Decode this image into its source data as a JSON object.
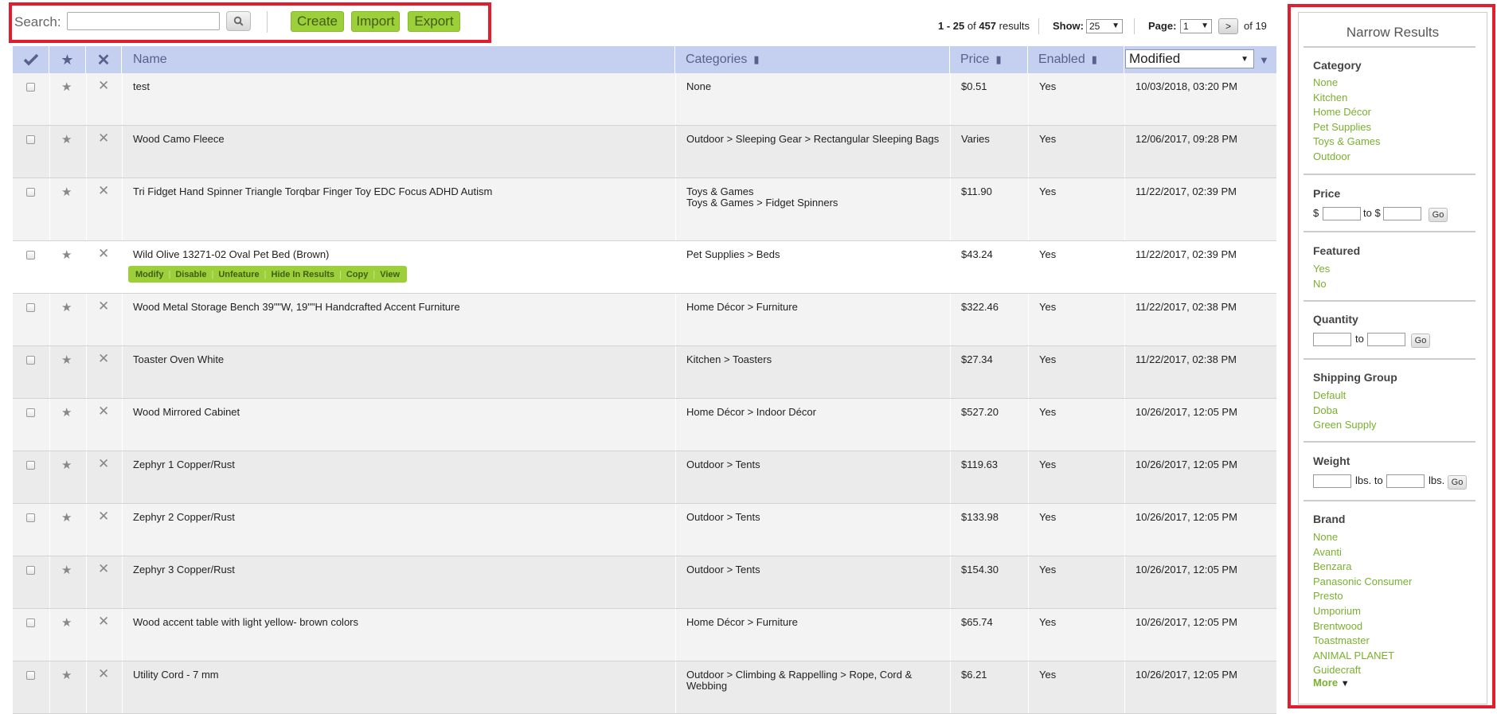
{
  "toolbar": {
    "search_label": "Search:",
    "search_value": "",
    "search_icon": "magnifier-icon",
    "create_label": "Create",
    "import_label": "Import",
    "export_label": "Export",
    "accent_color": "#9ccf3a",
    "highlight_color": "#e01e2e"
  },
  "pagination": {
    "range": "1 - 25",
    "of_word": "of",
    "total": "457",
    "results_word": "results",
    "show_label": "Show:",
    "show_value": "25",
    "page_label": "Page:",
    "page_value": "1",
    "next_label": ">",
    "of_pages": "of 19"
  },
  "table": {
    "header_icons": [
      "checkmark-icon",
      "star-icon",
      "close-icon"
    ],
    "columns": {
      "name": "Name",
      "categories": "Categories",
      "price": "Price",
      "enabled": "Enabled",
      "modified": "Modified"
    },
    "rows": [
      {
        "name": "test",
        "categories": [
          "None"
        ],
        "price": "$0.51",
        "enabled": "Yes",
        "modified": "10/03/2018, 03:20 PM"
      },
      {
        "name": "Wood Camo Fleece",
        "categories": [
          "Outdoor > Sleeping Gear > Rectangular Sleeping Bags"
        ],
        "price": "Varies",
        "enabled": "Yes",
        "modified": "12/06/2017, 09:28 PM"
      },
      {
        "name": "Tri Fidget Hand Spinner Triangle Torqbar Finger Toy EDC Focus ADHD Autism",
        "categories": [
          "Toys & Games",
          "Toys & Games > Fidget Spinners"
        ],
        "price": "$11.90",
        "enabled": "Yes",
        "modified": "11/22/2017, 02:39 PM"
      },
      {
        "name": "Wild Olive 13271-02 Oval Pet Bed (Brown)",
        "categories": [
          "Pet Supplies > Beds"
        ],
        "price": "$43.24",
        "enabled": "Yes",
        "modified": "11/22/2017, 02:39 PM"
      },
      {
        "name": "Wood Metal Storage Bench 39\"\"W, 19\"\"H Handcrafted Accent Furniture",
        "categories": [
          "Home Décor > Furniture"
        ],
        "price": "$322.46",
        "enabled": "Yes",
        "modified": "11/22/2017, 02:38 PM"
      },
      {
        "name": "Toaster Oven White",
        "categories": [
          "Kitchen > Toasters"
        ],
        "price": "$27.34",
        "enabled": "Yes",
        "modified": "11/22/2017, 02:38 PM"
      },
      {
        "name": "Wood Mirrored Cabinet",
        "categories": [
          "Home Décor > Indoor Décor"
        ],
        "price": "$527.20",
        "enabled": "Yes",
        "modified": "10/26/2017, 12:05 PM"
      },
      {
        "name": "Zephyr 1 Copper/Rust",
        "categories": [
          "Outdoor > Tents"
        ],
        "price": "$119.63",
        "enabled": "Yes",
        "modified": "10/26/2017, 12:05 PM"
      },
      {
        "name": "Zephyr 2 Copper/Rust",
        "categories": [
          "Outdoor > Tents"
        ],
        "price": "$133.98",
        "enabled": "Yes",
        "modified": "10/26/2017, 12:05 PM"
      },
      {
        "name": "Zephyr 3 Copper/Rust",
        "categories": [
          "Outdoor > Tents"
        ],
        "price": "$154.30",
        "enabled": "Yes",
        "modified": "10/26/2017, 12:05 PM"
      },
      {
        "name": "Wood accent table with light yellow- brown colors",
        "categories": [
          "Home Décor > Furniture"
        ],
        "price": "$65.74",
        "enabled": "Yes",
        "modified": "10/26/2017, 12:05 PM"
      },
      {
        "name": "Utility Cord - 7 mm",
        "categories": [
          "Outdoor > Climbing & Rappelling > Rope, Cord &",
          "Webbing"
        ],
        "price": "$6.21",
        "enabled": "Yes",
        "modified": "10/26/2017, 12:05 PM"
      }
    ],
    "row_actions": [
      "Modify",
      "Disable",
      "Unfeature",
      "Hide In Results",
      "Copy",
      "View"
    ]
  },
  "sidebar": {
    "title": "Narrow Results",
    "category": {
      "heading": "Category",
      "items": [
        "None",
        "Kitchen",
        "Home Décor",
        "Pet Supplies",
        "Toys & Games",
        "Outdoor"
      ]
    },
    "price": {
      "heading": "Price",
      "currency": "$",
      "to": "to $",
      "go": "Go"
    },
    "featured": {
      "heading": "Featured",
      "items": [
        "Yes",
        "No"
      ]
    },
    "quantity": {
      "heading": "Quantity",
      "to": "to",
      "go": "Go"
    },
    "shipping": {
      "heading": "Shipping Group",
      "items": [
        "Default",
        "Doba",
        "Green Supply"
      ]
    },
    "weight": {
      "heading": "Weight",
      "lbs_to": "lbs. to",
      "lbs": "lbs.",
      "go": "Go"
    },
    "brand": {
      "heading": "Brand",
      "items": [
        "None",
        "Avanti",
        "Benzara",
        "Panasonic Consumer",
        "Presto",
        "Umporium",
        "Brentwood",
        "Toastmaster",
        "ANIMAL PLANET",
        "Guidecraft"
      ],
      "more": "More"
    }
  }
}
